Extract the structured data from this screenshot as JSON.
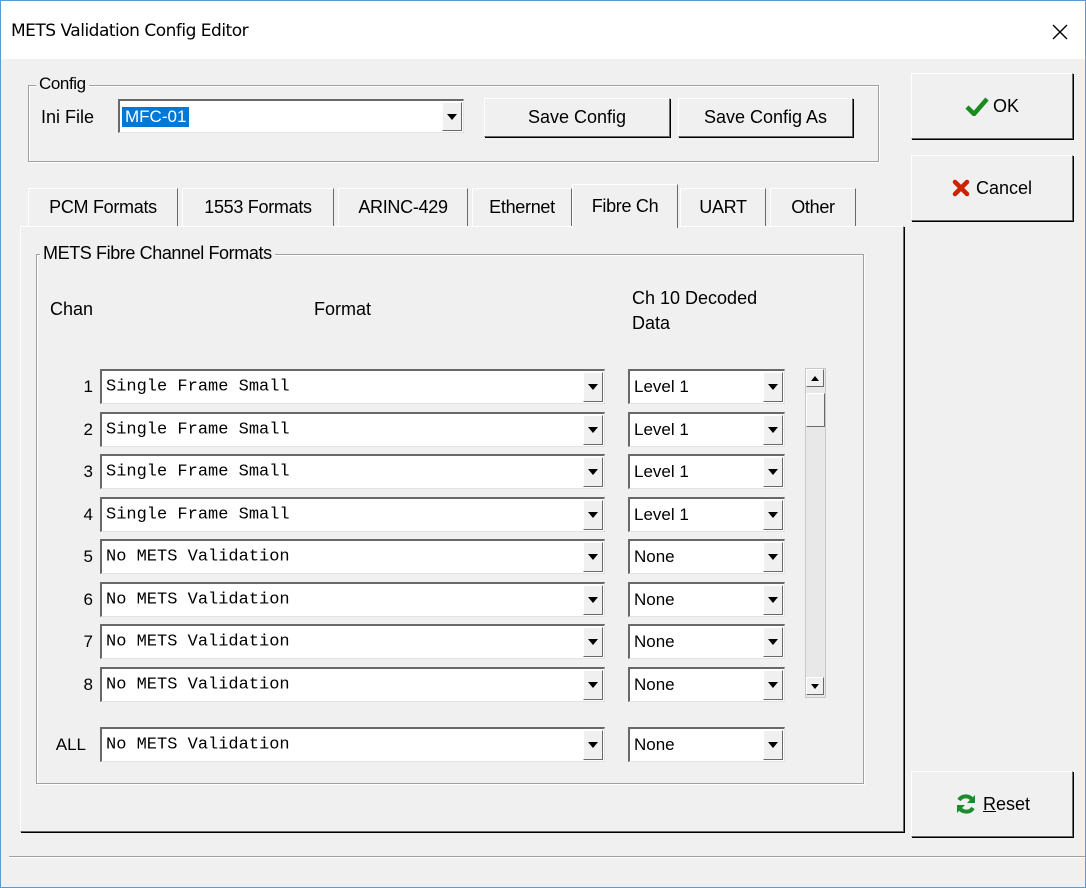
{
  "window": {
    "title": "METS Validation Config Editor"
  },
  "config_group": {
    "legend": "Config",
    "ini_label": "Ini File",
    "ini_value": "MFC-01",
    "save_label": "Save Config",
    "save_as_label": "Save Config As"
  },
  "buttons": {
    "ok": "OK",
    "cancel": "Cancel",
    "reset_prefix": "R",
    "reset_rest": "eset"
  },
  "tabs": [
    {
      "label": "PCM Formats"
    },
    {
      "label": "1553 Formats"
    },
    {
      "label": "ARINC-429"
    },
    {
      "label": "Ethernet"
    },
    {
      "label": "Fibre Ch",
      "active": true
    },
    {
      "label": "UART"
    },
    {
      "label": "Other"
    }
  ],
  "fibre": {
    "legend": "METS Fibre Channel Formats",
    "col_chan": "Chan",
    "col_format": "Format",
    "col_decoded_1": "Ch 10 Decoded",
    "col_decoded_2": "Data",
    "rows": [
      {
        "chan": "1",
        "format": "Single Frame Small",
        "decoded": "Level 1"
      },
      {
        "chan": "2",
        "format": "Single Frame Small",
        "decoded": "Level 1"
      },
      {
        "chan": "3",
        "format": "Single Frame Small",
        "decoded": "Level 1"
      },
      {
        "chan": "4",
        "format": "Single Frame Small",
        "decoded": "Level 1"
      },
      {
        "chan": "5",
        "format": "No METS Validation",
        "decoded": "None"
      },
      {
        "chan": "6",
        "format": "No METS Validation",
        "decoded": "None"
      },
      {
        "chan": "7",
        "format": "No METS Validation",
        "decoded": "None"
      },
      {
        "chan": "8",
        "format": "No METS Validation",
        "decoded": "None"
      }
    ],
    "all": {
      "chan": "ALL",
      "format": "No METS Validation",
      "decoded": "None"
    }
  },
  "colors": {
    "ini_highlight": "#0078d7",
    "ok_check": "#1a8a1a",
    "cancel_x": "#cc2200",
    "reset_icon": "#1e8a2e"
  }
}
